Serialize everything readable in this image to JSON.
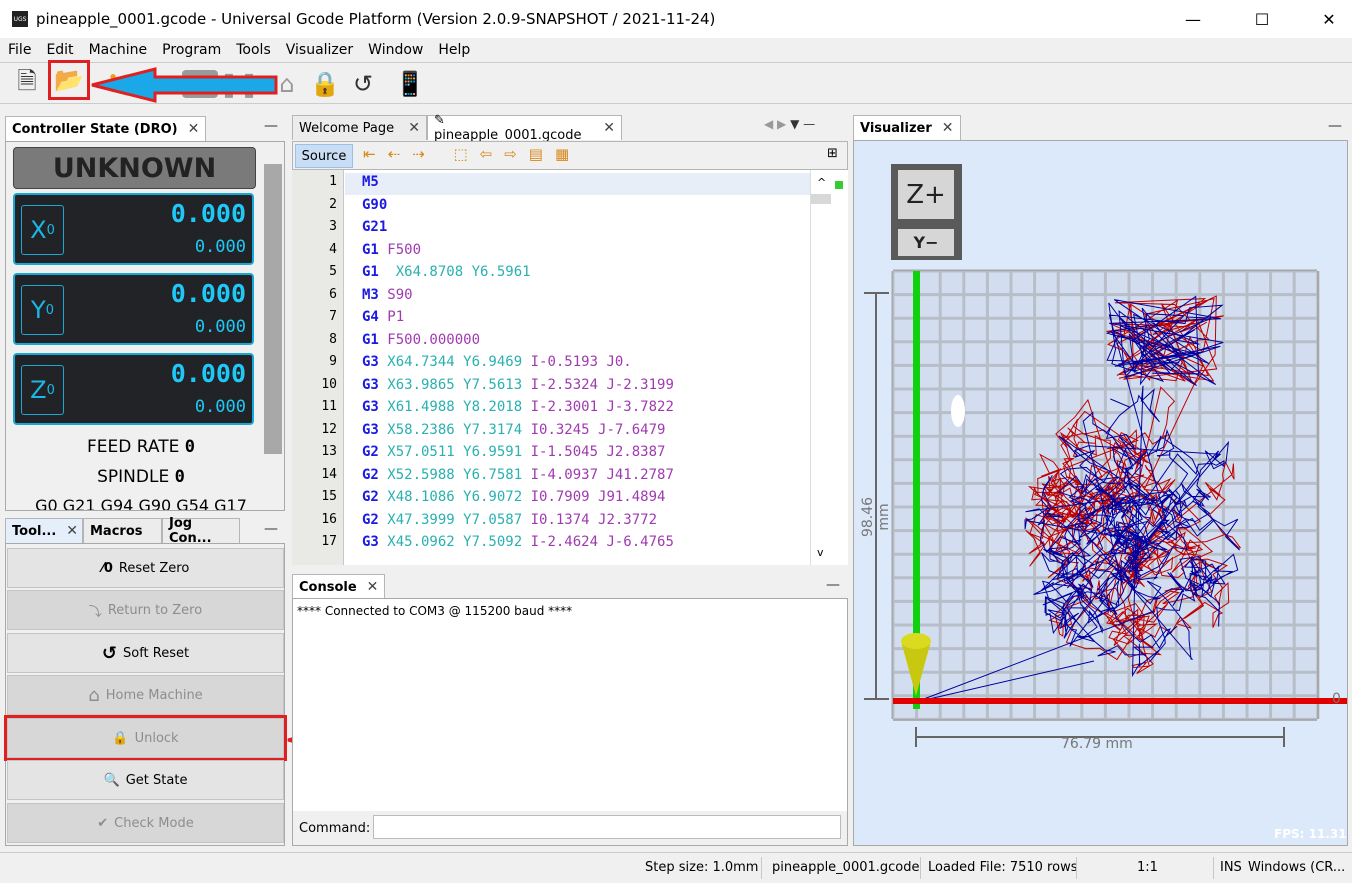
{
  "window": {
    "title": "pineapple_0001.gcode - Universal Gcode Platform (Version 2.0.9-SNAPSHOT / 2021-11-24)",
    "logo": "UGS",
    "minimize": "—",
    "maximize": "☐",
    "close": "✕"
  },
  "menu": [
    "File",
    "Edit",
    "Machine",
    "Program",
    "Tools",
    "Visualizer",
    "Window",
    "Help"
  ],
  "toolbar": [
    "new-file-icon",
    "open-folder-icon",
    "connect-icon",
    "play-icon",
    "pause-icon",
    "stop-icon",
    "home-icon",
    "lock-icon",
    "reset-icon",
    "pendant-icon"
  ],
  "dro": {
    "tab": "Controller State (DRO)",
    "state": "UNKNOWN",
    "axes": [
      {
        "label": "X",
        "sub": "0",
        "work": "0.000",
        "machine": "0.000"
      },
      {
        "label": "Y",
        "sub": "0",
        "work": "0.000",
        "machine": "0.000"
      },
      {
        "label": "Z",
        "sub": "0",
        "work": "0.000",
        "machine": "0.000"
      }
    ],
    "feed_rate": "FEED RATE",
    "feed_value": "0",
    "spindle": "SPINDLE",
    "spindle_value": "0",
    "gcode_state": "G0 G21 G94 G90 G54 G17"
  },
  "tools": {
    "tabs": [
      "Tool...",
      "Macros",
      "Jog Con..."
    ],
    "buttons": [
      {
        "label": "Reset Zero",
        "icon": "⁄0",
        "enabled": true
      },
      {
        "label": "Return to Zero",
        "icon": "⤵",
        "enabled": false
      },
      {
        "label": "Soft Reset",
        "icon": "↺",
        "enabled": true
      },
      {
        "label": "Home Machine",
        "icon": "⌂",
        "enabled": false
      },
      {
        "label": "Unlock",
        "icon": "🔒",
        "enabled": false
      },
      {
        "label": "Get State",
        "icon": "🔍",
        "enabled": true
      },
      {
        "label": "Check Mode",
        "icon": "✔",
        "enabled": false
      }
    ]
  },
  "editor": {
    "tabs": [
      "Welcome Page",
      "pineapple_0001.gcode"
    ],
    "source_label": "Source",
    "lines": [
      [
        [
          "M5",
          "g"
        ]
      ],
      [
        [
          "G90",
          "g"
        ]
      ],
      [
        [
          "G21",
          "g"
        ]
      ],
      [
        [
          "G1",
          "g"
        ],
        [
          " F500",
          "m"
        ]
      ],
      [
        [
          "G1",
          "g"
        ],
        [
          "  X64.8708 Y6.5961",
          "c"
        ]
      ],
      [
        [
          "M3",
          "g"
        ],
        [
          " S90",
          "m"
        ]
      ],
      [
        [
          "G4",
          "g"
        ],
        [
          " P1",
          "m"
        ]
      ],
      [
        [
          "G1",
          "g"
        ],
        [
          " F500.000000",
          "m"
        ]
      ],
      [
        [
          "G3",
          "g"
        ],
        [
          " X64.7344 Y6.9469",
          "c"
        ],
        [
          " I-0.5193 J0.",
          "m"
        ]
      ],
      [
        [
          "G3",
          "g"
        ],
        [
          " X63.9865 Y7.5613",
          "c"
        ],
        [
          " I-2.5324 J-2.3199",
          "m"
        ]
      ],
      [
        [
          "G3",
          "g"
        ],
        [
          " X61.4988 Y8.2018",
          "c"
        ],
        [
          " I-2.3001 J-3.7822",
          "m"
        ]
      ],
      [
        [
          "G3",
          "g"
        ],
        [
          " X58.2386 Y7.3174",
          "c"
        ],
        [
          " I0.3245 J-7.6479",
          "m"
        ]
      ],
      [
        [
          "G2",
          "g"
        ],
        [
          " X57.0511 Y6.9591",
          "c"
        ],
        [
          " I-1.5045 J2.8387",
          "m"
        ]
      ],
      [
        [
          "G2",
          "g"
        ],
        [
          " X52.5988 Y6.7581",
          "c"
        ],
        [
          " I-4.0937 J41.2787",
          "m"
        ]
      ],
      [
        [
          "G2",
          "g"
        ],
        [
          " X48.1086 Y6.9072",
          "c"
        ],
        [
          " I0.7909 J91.4894",
          "m"
        ]
      ],
      [
        [
          "G2",
          "g"
        ],
        [
          " X47.3999 Y7.0587",
          "c"
        ],
        [
          " I0.1374 J2.3772",
          "m"
        ]
      ],
      [
        [
          "G3",
          "g"
        ],
        [
          " X45.0962 Y7.5092",
          "c"
        ],
        [
          " I-2.4624 J-6.4765",
          "m"
        ]
      ]
    ]
  },
  "console": {
    "tab": "Console",
    "text": "**** Connected to COM3 @ 115200 baud ****",
    "command_label": "Command:",
    "command_value": ""
  },
  "visualizer": {
    "tab": "Visualizer",
    "cube_top": "Z+",
    "cube_bottom": "Y−",
    "height_label": "98.46 mm",
    "width_label": "76.79 mm",
    "zero_label": "0",
    "fps": "FPS: 11.31",
    "colors": {
      "x_axis": "#e00000",
      "y_axis": "#10d010",
      "path_a": "#c00000",
      "path_b": "#0000a0",
      "background": "#dce9fb"
    }
  },
  "status": {
    "step": "Step size: 1.0mm",
    "file": "pineapple_0001.gcode",
    "loaded": "Loaded File: 7510 rows",
    "pos": "1:1",
    "mode": "INS",
    "eol": "Windows (CR..."
  }
}
